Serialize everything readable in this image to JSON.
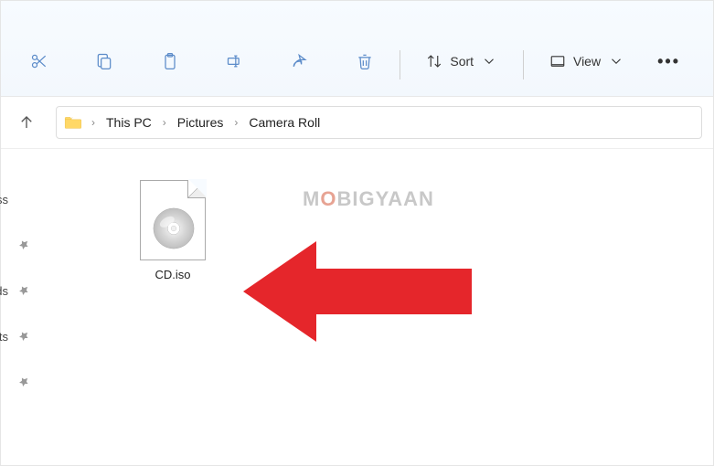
{
  "toolbar": {
    "sort_label": "Sort",
    "view_label": "View"
  },
  "breadcrumb": {
    "items": [
      "This PC",
      "Pictures",
      "Camera Roll"
    ]
  },
  "sidebar": {
    "items": [
      "ess",
      "",
      "ads",
      "nts",
      ""
    ]
  },
  "files": [
    {
      "name": "CD.iso"
    }
  ],
  "watermark": {
    "prefix": "M",
    "accent": "O",
    "suffix": "BIGYAAN"
  }
}
